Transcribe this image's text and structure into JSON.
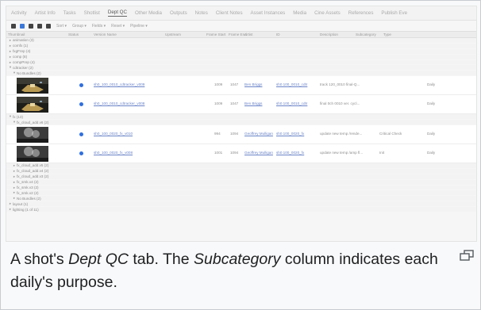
{
  "tabs": [
    "Activity",
    "Artist Info",
    "Tasks",
    "Shotlist",
    "Dept QC",
    "Other Media",
    "Outputs",
    "Notes",
    "Client Notes",
    "Asset Instances",
    "Media",
    "Cine Assets",
    "References",
    "Publish Eve"
  ],
  "active_tab_index": 4,
  "toolbar": {
    "dropdowns": [
      "Sort ▾",
      "Group ▾",
      "Fields ▾",
      "Reset ▾",
      "Pipeline ▾"
    ]
  },
  "columns": [
    "Thumbnail",
    "Status",
    "Version Name",
    "Upstream",
    "Frame Start",
    "Frame End",
    "Artist",
    "ID",
    "Description",
    "Subcategory",
    "Type"
  ],
  "tree_top": [
    {
      "caret": "▸",
      "label": "animation (3)"
    },
    {
      "caret": "▸",
      "label": "comfx (1)"
    },
    {
      "caret": "▸",
      "label": "fxgFrep (4)"
    },
    {
      "caret": "▸",
      "label": "comp (8)"
    },
    {
      "caret": "▸",
      "label": "compPrep (4)"
    },
    {
      "caret": "▾",
      "label": "cdtracker (2)"
    },
    {
      "caret": "▾",
      "label": "No Bundles (2)",
      "indent": 1
    }
  ],
  "versions_a": [
    {
      "name": "sh0_100_0010_cdtracker_v009",
      "frame_start": "1009",
      "frame_end": "1047",
      "artist": "Ben Briggs",
      "id": "sh0 100_0010_cdtr",
      "description": "track 120_0010 final-Q...",
      "type": "Daily"
    },
    {
      "name": "sh0_100_0010_cdtracker_v008",
      "frame_start": "1009",
      "frame_end": "1047",
      "artist": "Ben Briggs",
      "id": "sh0 100_0010_cdtr",
      "description": "final 0ch 0010 ver. cycl...",
      "type": "Daily"
    }
  ],
  "tree_mid": [
    {
      "caret": "▾",
      "label": "fx (13)"
    },
    {
      "caret": "▾",
      "label": "fx_cloud_add.v6 (2)",
      "indent": 1
    }
  ],
  "versions_b": [
    {
      "name": "sh0_100_0020_fx_v010",
      "frame_start": "994",
      "frame_end": "1094",
      "artist": "Geoffrey Mulligan",
      "id": "sh0 100_0020_fx",
      "description": "update new temp /rende...",
      "subcategory": "Critical Check",
      "type": "Daily"
    },
    {
      "name": "sh0_100_0020_fx_v008",
      "frame_start": "1001",
      "frame_end": "1094",
      "artist": "Geoffrey Mulligan",
      "id": "sh0 100_0020_fx",
      "description": "update new temp /amp fl...",
      "subcategory": "Init",
      "type": "Daily"
    }
  ],
  "tree_bottom": [
    {
      "caret": "▸",
      "label": "fx_cloud_add.v5 (2)",
      "indent": 1
    },
    {
      "caret": "▸",
      "label": "fx_cloud_add.v4 (2)",
      "indent": 1
    },
    {
      "caret": "▸",
      "label": "fx_cloud_add.v3 (2)",
      "indent": 1
    },
    {
      "caret": "▸",
      "label": "fx_smk.v4 (2)",
      "indent": 1
    },
    {
      "caret": "▸",
      "label": "fx_smk.v3 (2)",
      "indent": 1
    },
    {
      "caret": "▸",
      "label": "fx_smk.v2 (2)",
      "indent": 1
    },
    {
      "caret": "▸",
      "label": "No Bundles (2)",
      "indent": 1
    },
    {
      "caret": "▸",
      "label": "layout (1)"
    },
    {
      "caret": "▸",
      "label": "lighting (1 of 11)"
    }
  ],
  "caption": {
    "part1": "A shot's ",
    "dept_qc": "Dept QC",
    "part2": " tab. The ",
    "subcategory": "Subcategory",
    "part3": " column indicates each daily's purpose."
  }
}
